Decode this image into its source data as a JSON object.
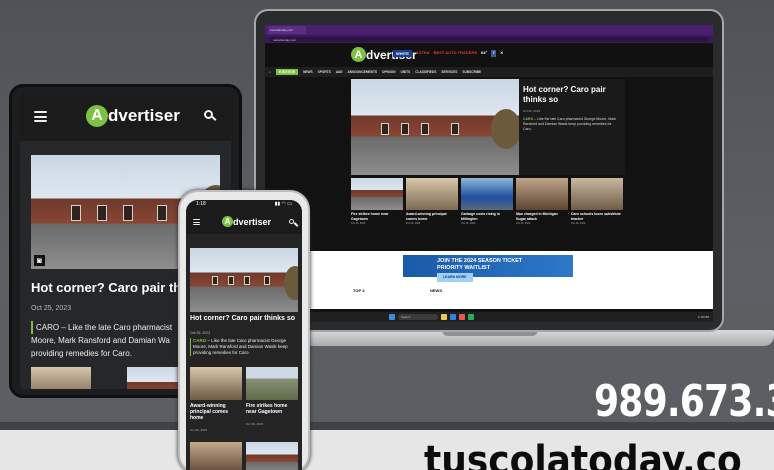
{
  "brand": {
    "logo_prefix": "A",
    "logo_text": "dvertiser",
    "accent": "#7cc242"
  },
  "story": {
    "headline": "Hot corner? Caro pair thinks so",
    "date": "Oct 25, 2023",
    "summary_place": "CARO",
    "summary_text": "– Like the late Caro pharmacist George Moore, Mark Ransford and Damian Wasik keep providing remedies for Caro."
  },
  "tablet": {
    "headline_visible": "Hot corner? Caro pair thir",
    "summary_lines": [
      "CARO – Like the late Caro pharmacist",
      "Moore, Mark Ransford and Damian Wa",
      "providing remedies for Caro."
    ]
  },
  "phone": {
    "time": "1:18",
    "cards": [
      {
        "title": "Award-winning principal comes home",
        "date": "Oct 26, 2023"
      },
      {
        "title": "Fire strikes home near Gagetown",
        "date": "Oct 26, 2023"
      }
    ]
  },
  "laptop": {
    "browser_tab": "tuscolatoday.com",
    "url": "tuscolatoday.com",
    "nav": [
      "E-EDITION",
      "NEWS",
      "SPORTS",
      "A&E",
      "ANNOUNCEMENTS",
      "OPINION",
      "OBITS",
      "CLASSIFIEDS",
      "SERVICES",
      "SUBSCRIBE"
    ],
    "ads": [
      "WHITE",
      "ASTRA",
      "BEST AUTO TRADERS"
    ],
    "weather": "64°",
    "cards": [
      {
        "title": "Fire strikes home near Gagetown",
        "date": "Oct 26, 2023"
      },
      {
        "title": "Award-winning principal comes home",
        "date": "Oct 26, 2023"
      },
      {
        "title": "Garbage costs rising in Millington",
        "date": "Oct 26, 2023"
      },
      {
        "title": "Man charged in Michigan Sugar attack",
        "date": "Oct 26, 2023"
      },
      {
        "title": "Caro schools loses substitute teacher",
        "date": "Oct 26, 2023"
      }
    ],
    "ad_line1": "JOIN THE 2024 SEASON TICKET",
    "ad_line2": "PRIORITY WAITLIST",
    "ad_button": "LEARN MORE",
    "lower_left": "TOP 3",
    "lower_mid": "NEWS",
    "taskbar_search": "Search",
    "clock": "1:18 PM"
  },
  "promo": {
    "phone": "989.673.3",
    "site": "tuscolatoday.co"
  }
}
